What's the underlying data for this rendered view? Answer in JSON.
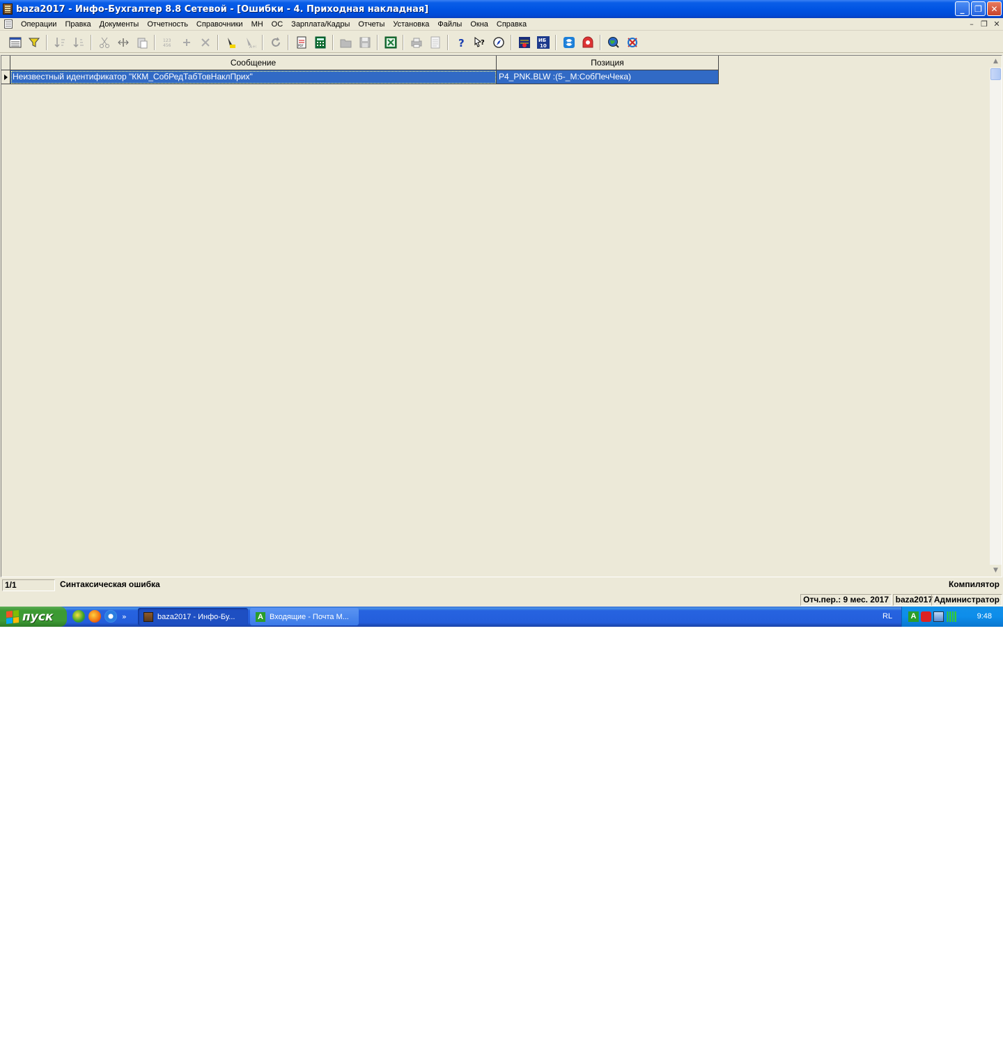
{
  "window": {
    "title": "baza2017 - Инфо-Бухгалтер 8.8 Сетевой - [Ошибки -   4. Приходная накладная]",
    "controls": {
      "minimize": "_",
      "restore": "❐",
      "close": "✕"
    }
  },
  "menu": {
    "items": [
      "Операции",
      "Правка",
      "Документы",
      "Отчетность",
      "Справочники",
      "МН",
      "ОС",
      "Зарплата/Кадры",
      "Отчеты",
      "Установка",
      "Файлы",
      "Окна",
      "Справка"
    ],
    "mdi": {
      "minimize": "–",
      "restore": "❐",
      "close": "✕"
    }
  },
  "toolbar": {
    "buttons": [
      "grid-icon",
      "filter-icon",
      "sort-asc-icon",
      "sort-desc-icon",
      "cut-icon",
      "copy-icon",
      "paste-icon",
      "number-icon",
      "add-icon",
      "delete-icon",
      "highlight-icon",
      "clear-filter-icon",
      "refresh-icon",
      "pdf-icon",
      "calculator-icon",
      "open-icon",
      "save-icon",
      "excel-icon",
      "print-icon",
      "preview-icon",
      "help-icon",
      "context-help-icon",
      "compass-icon",
      "info-icon",
      "ib10-icon",
      "teamviewer-icon",
      "remote-icon",
      "web-icon",
      "update-icon"
    ],
    "ib_label": "ИБ\n10"
  },
  "grid": {
    "columns": [
      "Сообщение",
      "Позиция"
    ],
    "rows": [
      {
        "message": "Неизвестный идентификатор \"ККМ_СобРедТабТовНаклПрих\"",
        "position": "P4_PNK.BLW :(5-_M:СобПечЧека)"
      }
    ],
    "selection_color": "#316ac5"
  },
  "status": {
    "count": "1/1",
    "error_type": "Синтаксическая ошибка",
    "source": "Компилятор",
    "period": "Отч.пер.: 9 мес. 2017",
    "database": "baza2017",
    "user": "Администратор"
  },
  "taskbar": {
    "start_label": "пуск",
    "quick_launch_more": "»",
    "tasks": [
      {
        "label": "baza2017 - Инфо-Бу...",
        "active": true
      },
      {
        "label": "Входящие - Почта M...",
        "active": false
      }
    ],
    "language": "RL",
    "clock": "9:48"
  }
}
